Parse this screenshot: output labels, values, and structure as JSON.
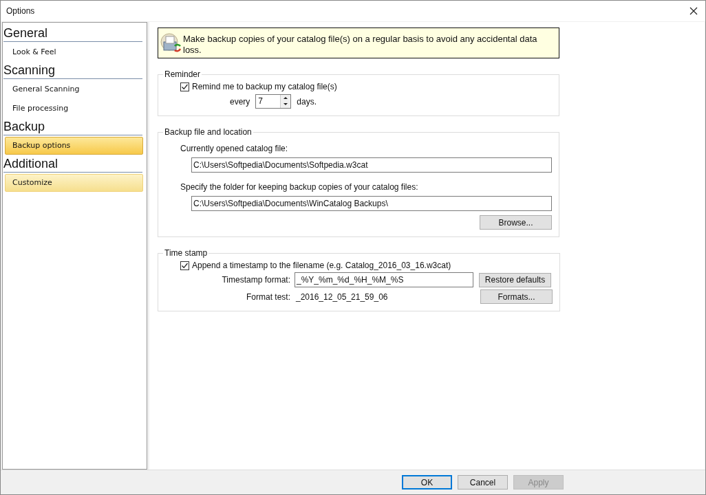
{
  "window": {
    "title": "Options"
  },
  "sidebar": {
    "groups": [
      {
        "title": "General",
        "items": [
          {
            "label": "Look & Feel",
            "selected": false,
            "hover": false
          }
        ]
      },
      {
        "title": "Scanning",
        "items": [
          {
            "label": "General Scanning",
            "selected": false,
            "hover": false
          },
          {
            "label": "File processing",
            "selected": false,
            "hover": false
          }
        ]
      },
      {
        "title": "Backup",
        "items": [
          {
            "label": "Backup options",
            "selected": true,
            "hover": false
          }
        ]
      },
      {
        "title": "Additional",
        "items": [
          {
            "label": "Customize",
            "selected": false,
            "hover": true
          }
        ]
      }
    ]
  },
  "banner": {
    "text": "Make backup copies of your catalog file(s) on a regular basis to avoid any accidental data loss."
  },
  "reminder": {
    "legend": "Reminder",
    "checkbox": {
      "label": "Remind me to backup my catalog file(s)",
      "checked": true
    },
    "every_label": "every",
    "interval": "7",
    "unit": "days."
  },
  "location": {
    "legend": "Backup file and location",
    "current_label": "Currently opened catalog file:",
    "current_value": "C:\\Users\\Softpedia\\Documents\\Softpedia.w3cat",
    "folder_label": "Specify the folder for keeping backup copies of your catalog files:",
    "folder_value": "C:\\Users\\Softpedia\\Documents\\WinCatalog Backups\\",
    "browse": "Browse..."
  },
  "timestamp": {
    "legend": "Time stamp",
    "checkbox": {
      "label": "Append a timestamp to the filename (e.g. Catalog_2016_03_16.w3cat)",
      "checked": true
    },
    "format_label": "Timestamp format:",
    "format_value": "_%Y_%m_%d_%H_%M_%S",
    "restore": "Restore defaults",
    "test_label": "Format test:",
    "test_value": "_2016_12_05_21_59_06",
    "formats": "Formats..."
  },
  "buttons": [
    {
      "label": "OK",
      "default": true,
      "disabled": false
    },
    {
      "label": "Cancel",
      "default": false,
      "disabled": false
    },
    {
      "label": "Apply",
      "default": false,
      "disabled": true
    }
  ]
}
